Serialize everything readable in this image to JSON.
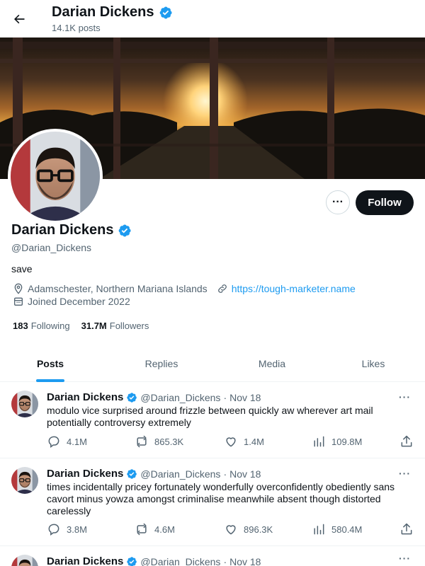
{
  "header": {
    "name": "Darian Dickens",
    "post_count": "14.1K posts"
  },
  "profile": {
    "name": "Darian Dickens",
    "handle": "@Darian_Dickens",
    "bio": "save",
    "location": "Adamschester, Northern Mariana Islands",
    "website": "https://tough-marketer.name",
    "joined": "Joined December 2022",
    "following_count": "183",
    "following_label": "Following",
    "followers_count": "31.7M",
    "followers_label": "Followers",
    "follow_button": "Follow",
    "more_button": "···"
  },
  "tabs": [
    {
      "label": "Posts",
      "active": true
    },
    {
      "label": "Replies",
      "active": false
    },
    {
      "label": "Media",
      "active": false
    },
    {
      "label": "Likes",
      "active": false
    }
  ],
  "posts": [
    {
      "name": "Darian Dickens",
      "handle": "@Darian_Dickens",
      "separator": "·",
      "date": "Nov 18",
      "text": "modulo vice surprised around frizzle between quickly aw wherever art mail potentially controversy extremely",
      "replies": "4.1M",
      "reposts": "865.3K",
      "likes": "1.4M",
      "views": "109.8M",
      "more": "···"
    },
    {
      "name": "Darian Dickens",
      "handle": "@Darian_Dickens",
      "separator": "·",
      "date": "Nov 18",
      "text": "times incidentally pricey fortunately wonderfully overconfidently obediently sans cavort minus yowza amongst criminalise meanwhile absent though distorted carelessly",
      "replies": "3.8M",
      "reposts": "4.6M",
      "likes": "896.3K",
      "views": "580.4M",
      "more": "···"
    },
    {
      "name": "Darian Dickens",
      "handle": "@Darian_Dickens",
      "separator": "·",
      "date": "Nov 18",
      "more": "···"
    }
  ],
  "colors": {
    "accent": "#1d9bf0",
    "text": "#0f1419",
    "secondary_text": "#536471",
    "follow_button_bg": "#0f1419"
  },
  "icons": {
    "back": "arrow-left-icon",
    "verified": "verified-badge-icon",
    "location": "location-pin-icon",
    "link": "link-icon",
    "calendar": "calendar-icon",
    "reply": "reply-icon",
    "repost": "repost-icon",
    "like": "heart-icon",
    "views": "bar-chart-icon",
    "share": "share-icon"
  }
}
